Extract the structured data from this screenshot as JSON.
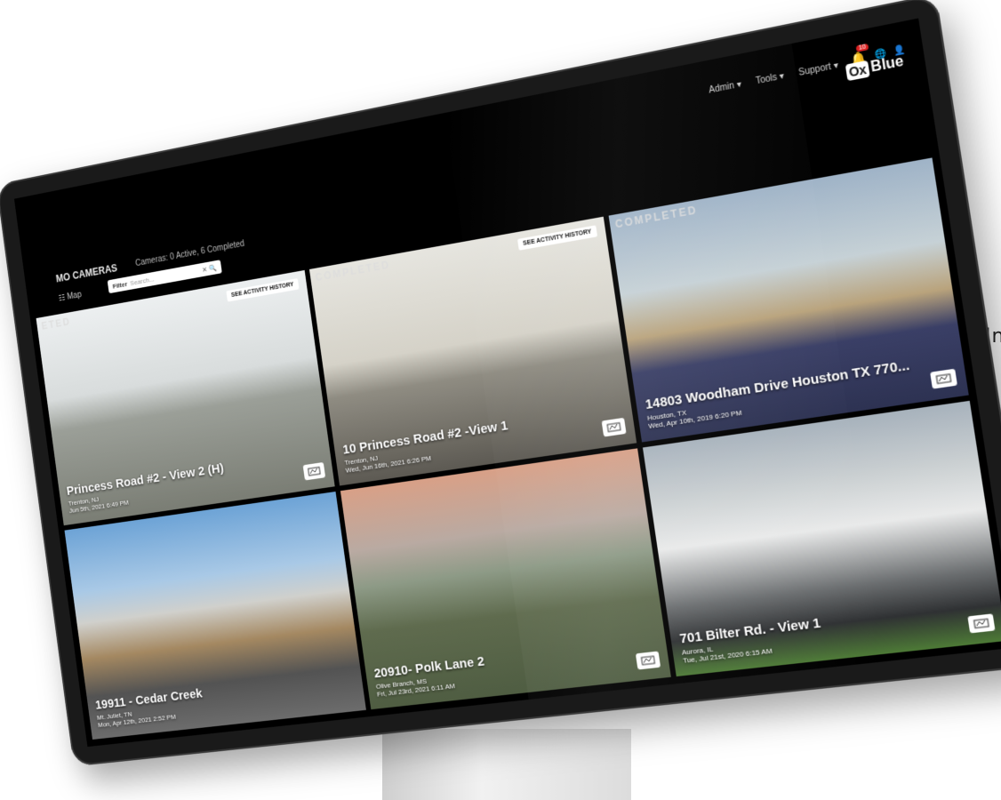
{
  "side_text": "In",
  "topbar": {
    "menu": [
      "Admin ▾",
      "Tools ▾",
      "Support ▾"
    ],
    "notification_count": "10",
    "logo_prefix": "Ox",
    "logo_suffix": "Blue"
  },
  "header": {
    "title": "MO CAMERAS",
    "subtitle": "Cameras: 0 Active, 6 Completed",
    "map_label": "Map",
    "filter_label": "Filter",
    "filter_placeholder": "Search..."
  },
  "tiles": [
    {
      "status": "ETED",
      "name": "Princess Road #2 - View 2 (H)",
      "location": "Trenton, NJ",
      "date": "Jun 5th, 2021 6:49 PM",
      "history": "SEE ACTIVITY HISTORY"
    },
    {
      "status": "COMPLETED",
      "name": "10 Princess Road #2 -View 1",
      "location": "Trenton, NJ",
      "date": "Wed, Jun 16th, 2021 6:26 PM",
      "history": "SEE ACTIVITY HISTORY"
    },
    {
      "status": "COMPLETED",
      "name": "14803 Woodham Drive Houston TX 770...",
      "location": "Houston, TX",
      "date": "Wed, Apr 10th, 2019 6:20 PM",
      "history": ""
    },
    {
      "status": "",
      "name": "19911 - Cedar Creek",
      "location": "Mt. Juliet, TN",
      "date": "Mon, Apr 12th, 2021 2:52 PM",
      "history": ""
    },
    {
      "status": "",
      "name": "20910- Polk Lane 2",
      "location": "Olive Branch, MS",
      "date": "Fri, Jul 23rd, 2021 6:11 AM",
      "history": ""
    },
    {
      "status": "",
      "name": "701 Bilter Rd. - View 1",
      "location": "Aurora, IL",
      "date": "Tue, Jul 21st, 2020 6:15 AM",
      "history": ""
    }
  ]
}
